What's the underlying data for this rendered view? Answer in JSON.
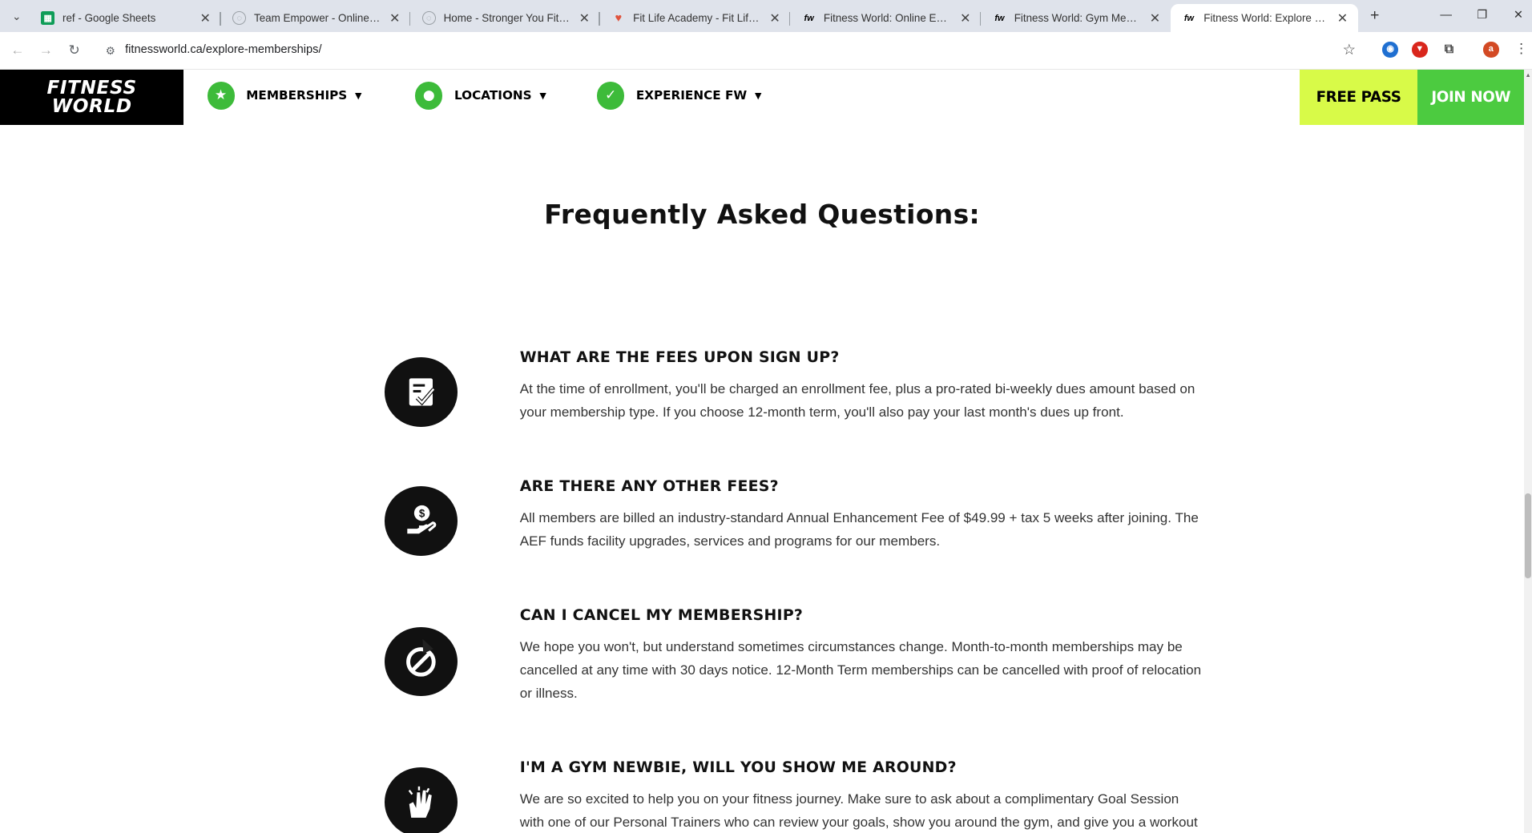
{
  "browser": {
    "tabs": [
      {
        "title": "ref - Google Sheets",
        "favicon": "sheets-icon",
        "color": "#0f9d58"
      },
      {
        "title": "Team Empower - Online Coachi",
        "favicon": "globe-icon",
        "color": "#9aa0a6"
      },
      {
        "title": "Home - Stronger You Fitness",
        "favicon": "globe-icon",
        "color": "#9aa0a6"
      },
      {
        "title": "Fit Life Academy - Fit Life Acad",
        "favicon": "heart-logo-icon",
        "color": "#e0533d"
      },
      {
        "title": "Fitness World: Online Exercise C",
        "favicon": "fw-logo-icon",
        "color": "#000000"
      },
      {
        "title": "Fitness World: Gym Membershi",
        "favicon": "fw-logo-icon",
        "color": "#000000"
      },
      {
        "title": "Fitness World: Explore Our Gym",
        "favicon": "fw-logo-icon",
        "color": "#000000"
      }
    ],
    "url": "fitnessworld.ca/explore-memberships/",
    "profile_initial": "a"
  },
  "header": {
    "logo_line1": "FITNESS",
    "logo_line2": "WORLD",
    "nav": [
      {
        "label": "MEMBERSHIPS",
        "icon": "star-icon"
      },
      {
        "label": "LOCATIONS",
        "icon": "map-pin-icon"
      },
      {
        "label": "EXPERIENCE FW",
        "icon": "check-icon"
      }
    ],
    "free_pass": "FREE PASS",
    "join_now": "JOIN NOW",
    "accent_lime": "#d8fa48",
    "accent_green": "#4ccb40"
  },
  "faq": {
    "title": "Frequently Asked Questions:",
    "items": [
      {
        "icon": "checklist-icon",
        "question": "WHAT ARE THE FEES UPON SIGN UP?",
        "answer": "At the time of enrollment, you'll be charged an enrollment fee, plus a pro-rated bi-weekly dues amount based on your membership type. If you choose 12-month term, you'll also pay your last month's dues up front."
      },
      {
        "icon": "money-hand-icon",
        "question": "ARE THERE ANY OTHER FEES?",
        "answer": "All members are billed an industry-standard Annual Enhancement Fee of $49.99 + tax 5 weeks after joining. The AEF funds facility upgrades, services and programs for our members."
      },
      {
        "icon": "cancel-icon",
        "question": "CAN I CANCEL MY MEMBERSHIP?",
        "answer": "We hope you won't, but understand sometimes circumstances change. Month-to-month memberships may be cancelled at any time with 30 days notice. 12-Month Term memberships can be cancelled with proof of relocation or illness."
      },
      {
        "icon": "high-five-icon",
        "question": "I'M A GYM NEWBIE, WILL YOU SHOW ME AROUND?",
        "answer": "We are so excited to help you on your fitness journey. Make sure to ask about a complimentary Goal Session with one of our Personal Trainers who can review your goals, show you around the gym, and give you a workout plan!"
      }
    ]
  }
}
